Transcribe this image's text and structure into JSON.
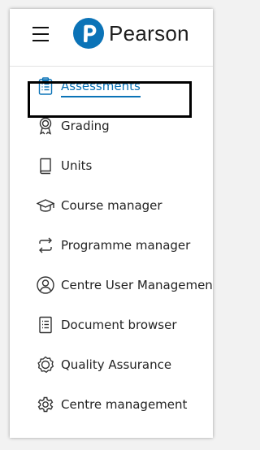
{
  "brand": {
    "name": "Pearson",
    "accent": "#0b73b7"
  },
  "nav": {
    "items": [
      {
        "label": "Assessments",
        "icon": "clipboard-icon",
        "active": true
      },
      {
        "label": "Grading",
        "icon": "award-ribbon-icon"
      },
      {
        "label": "Units",
        "icon": "book-icon"
      },
      {
        "label": "Course manager",
        "icon": "graduation-cap-icon"
      },
      {
        "label": "Programme manager",
        "icon": "swap-arrows-icon"
      },
      {
        "label": "Centre User Management",
        "icon": "user-circle-icon"
      },
      {
        "label": "Document browser",
        "icon": "document-list-icon"
      },
      {
        "label": "Quality Assurance",
        "icon": "badge-check-icon"
      },
      {
        "label": "Centre management",
        "icon": "gear-icon"
      }
    ]
  }
}
